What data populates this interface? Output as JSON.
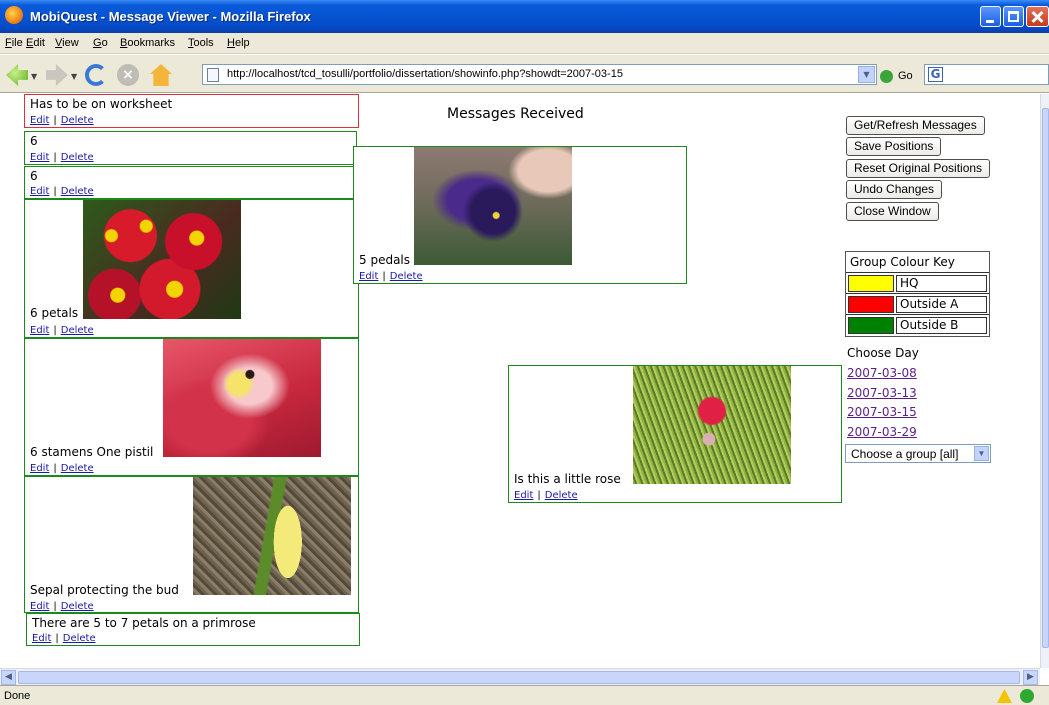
{
  "window": {
    "title": "MobiQuest - Message Viewer - Mozilla Firefox"
  },
  "menu": [
    "File",
    "Edit",
    "View",
    "Go",
    "Bookmarks",
    "Tools",
    "Help"
  ],
  "navbar": {
    "url": "http://localhost/tcd_tosulli/portfolio/dissertation/showinfo.php?showdt=2007-03-15",
    "go_label": "Go"
  },
  "page": {
    "heading": "Messages Received"
  },
  "actions": {
    "edit_label": "Edit",
    "delete_label": "Delete",
    "separator": "|"
  },
  "messages": [
    {
      "text": "Has to be on worksheet",
      "group": "Outside A",
      "has_photo": false
    },
    {
      "text": "6",
      "group": "Outside B",
      "has_photo": false
    },
    {
      "text": "6",
      "group": "Outside B",
      "has_photo": false
    },
    {
      "text": "6 petals",
      "group": "Outside B",
      "has_photo": true,
      "photo": "red primroses"
    },
    {
      "text": "6 stamens One pistil",
      "group": "Outside B",
      "has_photo": true,
      "photo": "red tulip close-up"
    },
    {
      "text": "Sepal protecting the bud",
      "group": "Outside B",
      "has_photo": true,
      "photo": "yellow flower bud"
    },
    {
      "text": "There are 5 to 7 petals on a primrose",
      "group": "Outside B",
      "has_photo": false
    },
    {
      "text": "5 pedals",
      "group": "Outside B",
      "has_photo": true,
      "photo": "purple pansy"
    },
    {
      "text": "Is this a little rose",
      "group": "Outside B",
      "has_photo": true,
      "photo": "small red rose bud"
    }
  ],
  "controls": {
    "refresh": "Get/Refresh Messages",
    "save": "Save Positions",
    "reset": "Reset Original Positions",
    "undo": "Undo Changes",
    "close": "Close Window"
  },
  "colour_key": {
    "title": "Group Colour Key",
    "groups": [
      {
        "name": "HQ",
        "color": "#ffff00"
      },
      {
        "name": "Outside A",
        "color": "#ff0000"
      },
      {
        "name": "Outside B",
        "color": "#008000"
      }
    ]
  },
  "days": {
    "label": "Choose Day",
    "dates": [
      "2007-03-08",
      "2007-03-13",
      "2007-03-15",
      "2007-03-29"
    ]
  },
  "group_select": {
    "value": "Choose a group [all]"
  },
  "status": {
    "text": "Done"
  }
}
